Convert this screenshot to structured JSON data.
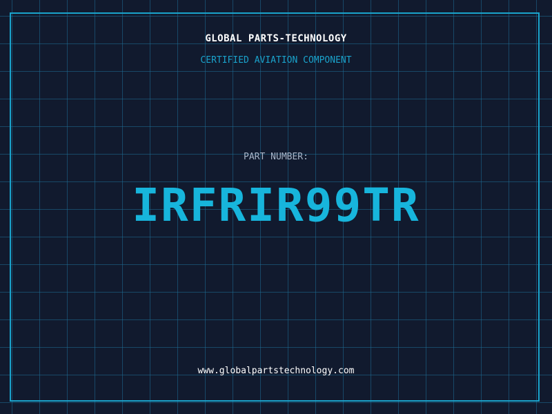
{
  "header": {
    "company": "GLOBAL PARTS-TECHNOLOGY",
    "subtitle": "CERTIFIED AVIATION COMPONENT"
  },
  "part": {
    "label": "PART NUMBER:",
    "value": "IRFRIR99TR"
  },
  "footer": {
    "website": "www.globalpartstechnology.com"
  },
  "colors": {
    "background": "#111a2e",
    "accent": "#1aa3cc",
    "part_number": "#17b5dc"
  }
}
